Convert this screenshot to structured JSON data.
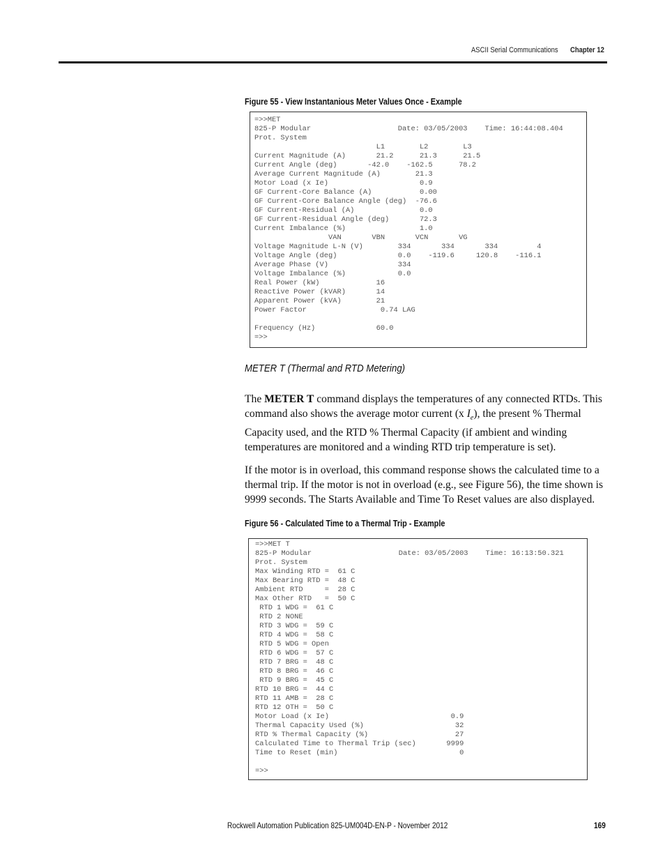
{
  "header": {
    "section": "ASCII Serial Communications",
    "chapter": "Chapter 12"
  },
  "figure55": {
    "caption": "Figure 55 - View Instantanious Meter Values Once - Example",
    "lines": [
      "=>>MET",
      "825-P Modular                    Date: 03/05/2003    Time: 16:44:08.404",
      "Prot. System",
      "                            L1        L2        L3",
      "Current Magnitude (A)       21.2      21.3      21.5",
      "Current Angle (deg)       -42.0    -162.5      78.2",
      "Average Current Magnitude (A)        21.3",
      "Motor Load (x Ie)                     0.9",
      "GF Current-Core Balance (A)           0.00",
      "GF Current-Core Balance Angle (deg)  -76.6",
      "GF Current-Residual (A)               0.0",
      "GF Current-Residual Angle (deg)       72.3",
      "Current Imbalance (%)                 1.0",
      "                 VAN       VBN       VCN       VG",
      "Voltage Magnitude L-N (V)        334       334       334         4",
      "Voltage Angle (deg)              0.0    -119.6     120.8    -116.1",
      "Average Phase (V)                334",
      "Voltage Imbalance (%)            0.0",
      "Real Power (kW)             16",
      "Reactive Power (kVAR)       14",
      "Apparent Power (kVA)        21",
      "Power Factor                 0.74 LAG",
      "",
      "Frequency (Hz)              60.0",
      "=>>"
    ]
  },
  "section": {
    "title": "METER T (Thermal and RTD Metering)",
    "para1": {
      "pre_bold": "The ",
      "bold": "METER T",
      "part1": " command displays the temperatures of any connected RTDs. This command also shows the average motor current (x ",
      "ie_main": "I",
      "ie_sub": "e",
      "part2": "), the present % Thermal Capacity used, and the RTD % Thermal Capacity (if ambient and winding temperatures are monitored and a winding RTD trip temperature is set)."
    },
    "para2": "If the motor is in overload, this command response shows the calculated time to a thermal trip. If the motor is not in overload (e.g., see Figure 56), the time shown is 9999 seconds. The Starts Available and Time To Reset values are also displayed."
  },
  "figure56": {
    "caption": "Figure 56 - Calculated Time to a Thermal Trip - Example",
    "lines": [
      "=>>MET T",
      "825-P Modular                    Date: 03/05/2003    Time: 16:13:50.321",
      "Prot. System",
      "Max Winding RTD =  61 C",
      "Max Bearing RTD =  48 C",
      "Ambient RTD     =  28 C",
      "Max Other RTD   =  50 C",
      " RTD 1 WDG =  61 C",
      " RTD 2 NONE",
      " RTD 3 WDG =  59 C",
      " RTD 4 WDG =  58 C",
      " RTD 5 WDG = Open",
      " RTD 6 WDG =  57 C",
      " RTD 7 BRG =  48 C",
      " RTD 8 BRG =  46 C",
      " RTD 9 BRG =  45 C",
      "RTD 10 BRG =  44 C",
      "RTD 11 AMB =  28 C",
      "RTD 12 OTH =  50 C",
      "Motor Load (x Ie)                            0.9",
      "Thermal Capacity Used (%)                     32",
      "RTD % Thermal Capacity (%)                    27",
      "Calculated Time to Thermal Trip (sec)       9999",
      "Time to Reset (min)                            0",
      "",
      "=>>"
    ]
  },
  "footer": {
    "publication": "Rockwell Automation Publication 825-UM004D-EN-P - November 2012",
    "page_number": "169"
  }
}
